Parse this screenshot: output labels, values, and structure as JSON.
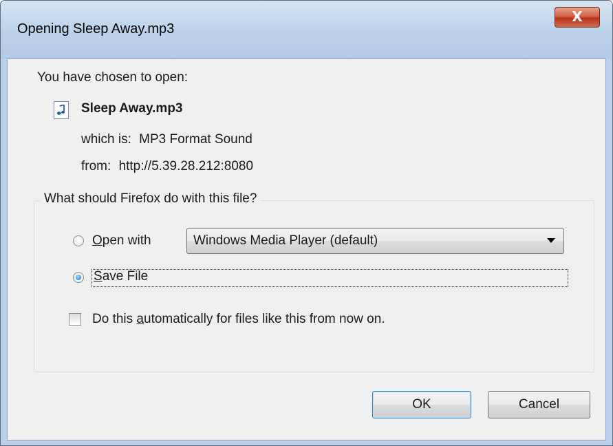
{
  "window": {
    "title": "Opening Sleep Away.mp3",
    "close_glyph": "X"
  },
  "intro": "You have chosen to open:",
  "file": {
    "name": "Sleep Away.mp3",
    "icon": "audio-file-icon",
    "which_is_label": "which is:",
    "type": "MP3 Format Sound",
    "from_label": "from:",
    "source": "http://5.39.28.212:8080"
  },
  "group": {
    "legend": "What should Firefox do with this file?",
    "open_with": {
      "prefix": "",
      "accel": "O",
      "rest": "pen with",
      "selected": false,
      "app": "Windows Media Player (default)"
    },
    "save_file": {
      "accel": "S",
      "rest": "ave File",
      "selected": true
    },
    "auto": {
      "prefix": "Do this ",
      "accel": "a",
      "rest": "utomatically for files like this from now on.",
      "checked": false
    }
  },
  "buttons": {
    "ok": "OK",
    "cancel": "Cancel"
  },
  "colors": {
    "titlebar": "#bcd2ea",
    "client": "#f0f0f0",
    "close_button": "#c8452c",
    "radio_checked": "#1d6fb8"
  }
}
